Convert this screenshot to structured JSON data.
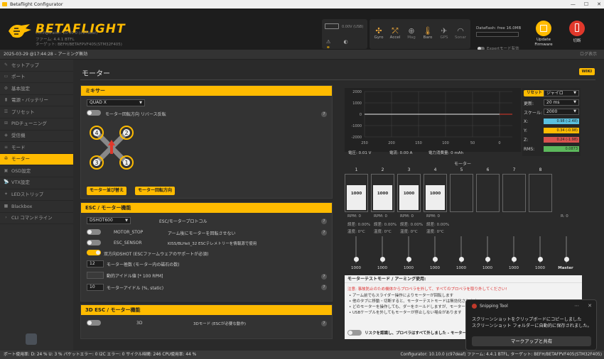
{
  "window": {
    "title": "Betaflight Configurator",
    "min": "—",
    "max": "☐",
    "close": "✕"
  },
  "header": {
    "logo": "BETAFLIGHT",
    "sub1": "Configurator: 10.10.0 (c97deaf)",
    "sub2": "ファーム: 4.4.1 BTFL",
    "sub3": "ターゲット: BEFH/BETAFPVF405(STM32F405)",
    "battery_label": "0.00V (USB)",
    "sensors": [
      {
        "name": "Gyro",
        "icon": "gyro-icon",
        "glyph": "✣",
        "on": true
      },
      {
        "name": "Accel",
        "icon": "accel-icon",
        "glyph": "⤱",
        "on": true
      },
      {
        "name": "Mag",
        "icon": "mag-icon",
        "glyph": "⊕",
        "on": false
      },
      {
        "name": "Baro",
        "icon": "baro-icon",
        "glyph": "🌡",
        "on": true
      },
      {
        "name": "GPS",
        "icon": "gps-icon",
        "glyph": "✈",
        "on": false
      },
      {
        "name": "Sonar",
        "icon": "sonar-icon",
        "glyph": "◠",
        "on": false
      }
    ],
    "dataflash": "Dataflash: free 16.0MB",
    "expert": "Expertモード有効",
    "update_label": "Update\nFirmware",
    "disconnect_label": "切断"
  },
  "logbar": {
    "text": "2025-03-29 @17:44:28 – アーミング無効",
    "right": "ログ表示"
  },
  "sidebar": {
    "items": [
      {
        "label": "セットアップ",
        "icon": "wrench-icon",
        "glyph": "✎"
      },
      {
        "label": "ポート",
        "icon": "ports-icon",
        "glyph": "▭"
      },
      {
        "label": "基本設定",
        "icon": "config-icon",
        "glyph": "⚙"
      },
      {
        "label": "電源・バッテリー",
        "icon": "power-icon",
        "glyph": "▮"
      },
      {
        "label": "プリセット",
        "icon": "presets-icon",
        "glyph": "☰"
      },
      {
        "label": "PIDチューニング",
        "icon": "pid-icon",
        "glyph": "⊞"
      },
      {
        "label": "受信機",
        "icon": "receiver-icon",
        "glyph": "◈"
      },
      {
        "label": "モード",
        "icon": "modes-icon",
        "glyph": "≡"
      },
      {
        "label": "モーター",
        "icon": "motor-icon",
        "glyph": "✇"
      },
      {
        "label": "OSD設定",
        "icon": "osd-icon",
        "glyph": "▣"
      },
      {
        "label": "VTX設定",
        "icon": "vtx-icon",
        "glyph": "📡"
      },
      {
        "label": "LEDストリップ",
        "icon": "led-icon",
        "glyph": "✦"
      },
      {
        "label": "Blackbox",
        "icon": "blackbox-icon",
        "glyph": "■"
      },
      {
        "label": "CLI コマンドライン",
        "icon": "cli-icon",
        "glyph": "›"
      }
    ],
    "active_index": 8
  },
  "page": {
    "title": "モーター",
    "wiki": "WIKI"
  },
  "mixer": {
    "head": "ミキサー",
    "type": "QUAD X",
    "reverse_label": "モーター回転方向 リバース反転",
    "btn_reorder": "モーター並び替え",
    "btn_direction": "モーター回転方向",
    "motors": [
      "4",
      "2",
      "3",
      "1"
    ]
  },
  "esc": {
    "head": "ESC / モーター機能",
    "protocol_value": "DSHOT600",
    "protocol_label": "ESC/モータープロトコル",
    "motor_stop": "MOTOR_STOP",
    "motor_stop_desc": "アーム後にモーターを回転させない",
    "esc_sensor": "ESC_SENSOR",
    "esc_sensor_desc": "KISS/BLHeli_32 ESCテレメトリーを情報源で使用",
    "bidir_label": "双方向DSHOT (ESCファームウェアのサポートが必須)",
    "poles_value": "12",
    "poles_label": "モーター極数 (モーター内の磁石の数)",
    "idle_rpm_value": "",
    "idle_rpm_label": "動的アイドル値 [* 100 RPM]",
    "idle_value": "10",
    "idle_label": "モーターアイドル (%, static)"
  },
  "threed": {
    "head": "3D ESC / モーター機能",
    "label": "3D",
    "desc": "3Dモード (ESCが必要な動作)"
  },
  "graph": {
    "y_ticks": [
      "2000",
      "1000",
      "0",
      "-1000",
      "-2000"
    ],
    "x_ticks": [
      "250",
      "200",
      "150",
      "100",
      "50",
      "0"
    ],
    "reset": "リセット",
    "sensor_value": "ジャイロ",
    "refresh_label": "更新:",
    "refresh_value": "20 ms",
    "scale_label": "スケール:",
    "scale_value": "2000",
    "x_label": "X:",
    "x_val": "0.98 (-2.48)",
    "y_label": "Y:",
    "y_val": "0.34 (-0.98)",
    "z_label": "Z:",
    "z_val": "0.24 (-1.98)",
    "rms_label": "RMS:",
    "rms_val": "0.0873",
    "voltage": "電圧: 0.01 V",
    "current": "電流: 0.00 A",
    "consumed": "電力消費量: 0 mAh"
  },
  "motors": {
    "head": "モーター",
    "cols": [
      {
        "label": "1",
        "value": "1000",
        "level": 0.7,
        "stats": [
          "RPM: 0",
          "誤差: 0.00%",
          "温度: 0°C"
        ]
      },
      {
        "label": "2",
        "value": "1000",
        "level": 0.7,
        "stats": [
          "RPM: 0",
          "誤差: 0.00%",
          "温度: 0°C"
        ]
      },
      {
        "label": "3",
        "value": "1000",
        "level": 0.7,
        "stats": [
          "RPM: 0",
          "誤差: 0.00%",
          "温度: 0°C"
        ]
      },
      {
        "label": "4",
        "value": "1000",
        "level": 0.7,
        "stats": [
          "RPM: 0",
          "誤差: 0.00%",
          "温度: 0°C"
        ]
      },
      {
        "label": "5",
        "value": "",
        "level": 0,
        "stats": [
          "",
          "",
          ""
        ]
      },
      {
        "label": "6",
        "value": "",
        "level": 0,
        "stats": [
          "",
          "",
          ""
        ]
      },
      {
        "label": "7",
        "value": "",
        "level": 0,
        "stats": [
          "",
          "",
          ""
        ]
      },
      {
        "label": "8",
        "value": "",
        "level": 0,
        "stats": [
          "",
          "",
          ""
        ]
      }
    ],
    "slider_values": [
      "1000",
      "1000",
      "1000",
      "1000",
      "1000",
      "1000",
      "1000",
      "1000"
    ],
    "master_value": "Master",
    "rpm_right": "R: 0"
  },
  "notice": {
    "head": "モーターテストモード / アーミング使用:",
    "warning": "注意: 事故防止のため機体からプロペラを外して、すべてのプロペラを取り外してください!",
    "items": [
      "• アーム前でもスライダー操作によりモーターが回転します",
      "• 他のタブに移動・切断すると、モーターテストモードは無効化されます",
      "• どのモーターを操作しても、ダーをホールドしますが、モーターテストは...",
      "• USBケーブルを外してもモーターが停止しない場合があります"
    ],
    "ack": "リスクを認識し、プロペラはすべて外しました - モーターテスト..."
  },
  "toast": {
    "title": "Snipping Tool",
    "line1": "スクリーンショットをクリップボードにコピーしました",
    "line2": "スクリーンショット フォルダーに自動的に保存されました。",
    "button": "マークアップと共有"
  },
  "status": {
    "text": "ポート使用率: D: 24 % U: 3 %   パケットエラー: 0   I2C エラー: 0   サイクル時間: 246   CPU使用率: 44 %",
    "right": "Configurator: 10.10.0 (c97deaf)   ファーム: 4.4.1 BTFL, ターゲット: BEFH/BETAFPVF405(STM32F405)"
  }
}
